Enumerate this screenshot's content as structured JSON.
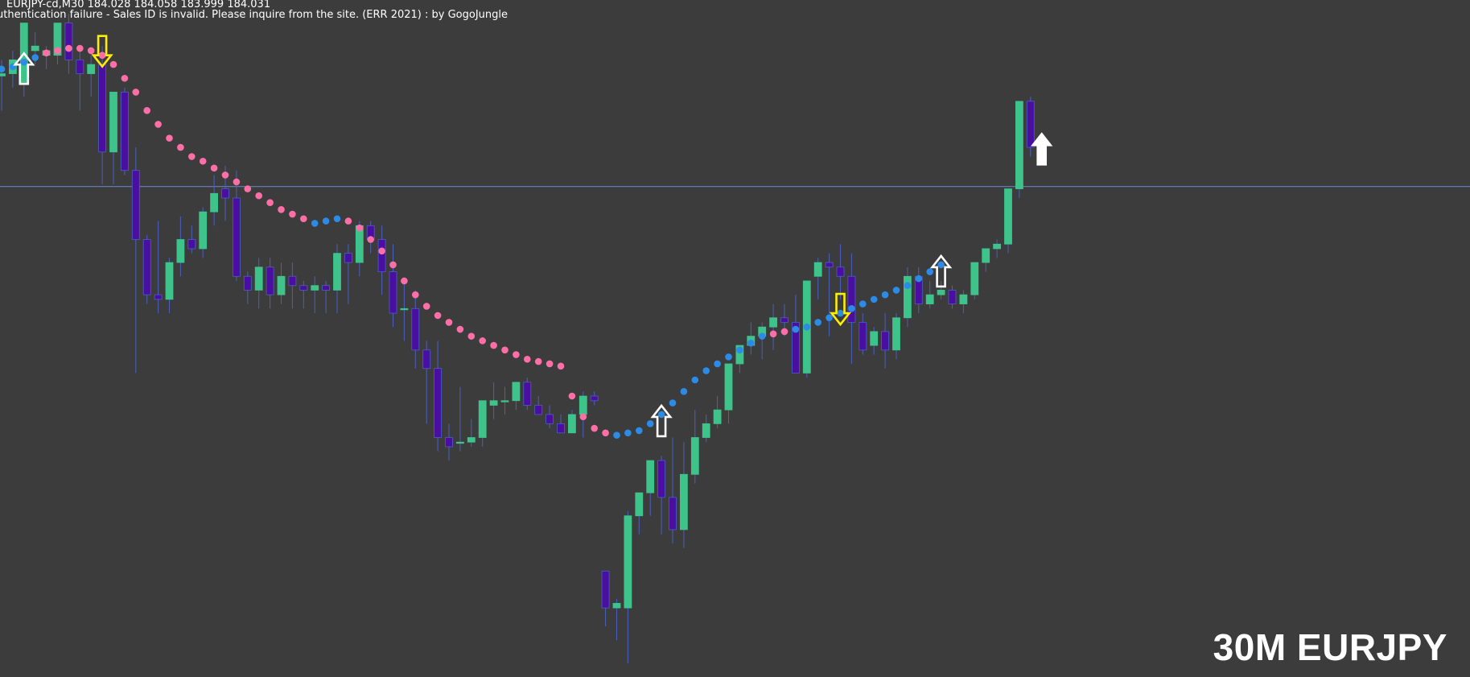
{
  "header": {
    "symbol_line": "EURJPY-cd,M30  184.028 184.058 183.999 184.031",
    "message": "uthentication failure - Sales ID is invalid. Please inquire from the site. (ERR 2021) : by GogoJungle"
  },
  "badge": "30M EURJPY",
  "colors": {
    "background": "#3c3c3c",
    "bull": "#3ec48a",
    "bear": "#4a0fa0",
    "wick": "#4a5fc0",
    "sar_down": "#ff6fa7",
    "sar_up": "#2b8be6",
    "buy_arrow": "#ffffff",
    "sell_arrow": "#ffee00",
    "price_line": "#6c8ccc"
  },
  "chart_data": {
    "type": "candlestick",
    "timeframe": "M30",
    "symbol": "EURJPY",
    "price_line": 183.935,
    "ylim": [
      182.87,
      184.34
    ],
    "candles": [
      [
        184.175,
        184.21,
        184.1,
        184.18
      ],
      [
        184.18,
        184.23,
        184.15,
        184.21
      ],
      [
        184.16,
        184.29,
        184.13,
        184.29
      ],
      [
        184.23,
        184.27,
        184.2,
        184.24
      ],
      [
        184.22,
        184.24,
        184.19,
        184.23
      ],
      [
        184.22,
        184.29,
        184.2,
        184.29
      ],
      [
        184.29,
        184.31,
        184.18,
        184.21
      ],
      [
        184.21,
        184.24,
        184.1,
        184.18
      ],
      [
        184.18,
        184.22,
        184.13,
        184.2
      ],
      [
        184.2,
        184.24,
        183.94,
        184.01
      ],
      [
        184.01,
        184.14,
        183.94,
        184.14
      ],
      [
        184.14,
        184.15,
        183.96,
        183.97
      ],
      [
        183.97,
        184.02,
        183.53,
        183.82
      ],
      [
        183.82,
        183.83,
        183.68,
        183.7
      ],
      [
        183.7,
        183.86,
        183.66,
        183.69
      ],
      [
        183.69,
        183.78,
        183.66,
        183.77
      ],
      [
        183.77,
        183.87,
        183.74,
        183.82
      ],
      [
        183.82,
        183.85,
        183.79,
        183.8
      ],
      [
        183.8,
        183.89,
        183.78,
        183.88
      ],
      [
        183.88,
        183.96,
        183.85,
        183.92
      ],
      [
        183.93,
        183.98,
        183.86,
        183.91
      ],
      [
        183.91,
        183.97,
        183.73,
        183.74
      ],
      [
        183.74,
        183.75,
        183.68,
        183.71
      ],
      [
        183.71,
        183.78,
        183.67,
        183.76
      ],
      [
        183.76,
        183.78,
        183.67,
        183.7
      ],
      [
        183.7,
        183.77,
        183.68,
        183.74
      ],
      [
        183.74,
        183.77,
        183.67,
        183.72
      ],
      [
        183.72,
        183.73,
        183.67,
        183.71
      ],
      [
        183.71,
        183.74,
        183.66,
        183.72
      ],
      [
        183.72,
        183.73,
        183.66,
        183.71
      ],
      [
        183.71,
        183.81,
        183.66,
        183.79
      ],
      [
        183.79,
        183.81,
        183.68,
        183.77
      ],
      [
        183.77,
        183.86,
        183.74,
        183.85
      ],
      [
        183.85,
        183.86,
        183.79,
        183.82
      ],
      [
        183.82,
        183.85,
        183.7,
        183.75
      ],
      [
        183.75,
        183.81,
        183.63,
        183.66
      ],
      [
        183.67,
        183.73,
        183.6,
        183.67
      ],
      [
        183.67,
        183.71,
        183.54,
        183.58
      ],
      [
        183.58,
        183.6,
        183.42,
        183.54
      ],
      [
        183.54,
        183.6,
        183.36,
        183.39
      ],
      [
        183.39,
        183.42,
        183.34,
        183.37
      ],
      [
        183.38,
        183.5,
        183.36,
        183.38
      ],
      [
        183.38,
        183.43,
        183.37,
        183.39
      ],
      [
        183.39,
        183.47,
        183.37,
        183.47
      ],
      [
        183.46,
        183.51,
        183.43,
        183.47
      ],
      [
        183.47,
        183.5,
        183.44,
        183.47
      ],
      [
        183.47,
        183.51,
        183.45,
        183.51
      ],
      [
        183.51,
        183.52,
        183.45,
        183.46
      ],
      [
        183.46,
        183.48,
        183.44,
        183.44
      ],
      [
        183.44,
        183.46,
        183.41,
        183.42
      ],
      [
        183.42,
        183.44,
        183.4,
        183.4
      ],
      [
        183.4,
        183.45,
        183.4,
        183.44
      ],
      [
        183.44,
        183.49,
        183.39,
        183.48
      ],
      [
        183.48,
        183.49,
        183.46,
        183.47
      ],
      [
        183.1,
        183.1,
        182.98,
        183.02
      ],
      [
        183.02,
        183.04,
        182.95,
        183.03
      ],
      [
        183.02,
        183.23,
        182.9,
        183.22
      ],
      [
        183.22,
        183.27,
        183.18,
        183.27
      ],
      [
        183.27,
        183.34,
        183.22,
        183.34
      ],
      [
        183.34,
        183.35,
        183.18,
        183.26
      ],
      [
        183.26,
        183.39,
        183.16,
        183.19
      ],
      [
        183.19,
        183.38,
        183.15,
        183.31
      ],
      [
        183.31,
        183.45,
        183.29,
        183.39
      ],
      [
        183.39,
        183.44,
        183.38,
        183.42
      ],
      [
        183.42,
        183.48,
        183.41,
        183.45
      ],
      [
        183.45,
        183.49,
        183.42,
        183.55
      ],
      [
        183.55,
        183.59,
        183.53,
        183.59
      ],
      [
        183.59,
        183.64,
        183.57,
        183.61
      ],
      [
        183.61,
        183.64,
        183.56,
        183.63
      ],
      [
        183.63,
        183.68,
        183.58,
        183.65
      ],
      [
        183.65,
        183.68,
        183.61,
        183.64
      ],
      [
        183.64,
        183.7,
        183.55,
        183.53
      ],
      [
        183.53,
        183.66,
        183.52,
        183.73
      ],
      [
        183.74,
        183.78,
        183.69,
        183.77
      ],
      [
        183.77,
        183.79,
        183.61,
        183.76
      ],
      [
        183.76,
        183.81,
        183.69,
        183.74
      ],
      [
        183.74,
        183.79,
        183.55,
        183.64
      ],
      [
        183.64,
        183.66,
        183.57,
        183.58
      ],
      [
        183.59,
        183.63,
        183.57,
        183.62
      ],
      [
        183.62,
        183.66,
        183.54,
        183.58
      ],
      [
        183.58,
        183.66,
        183.56,
        183.65
      ],
      [
        183.65,
        183.76,
        183.63,
        183.74
      ],
      [
        183.74,
        183.76,
        183.66,
        183.68
      ],
      [
        183.68,
        183.73,
        183.67,
        183.7
      ],
      [
        183.7,
        183.73,
        183.69,
        183.71
      ],
      [
        183.71,
        183.72,
        183.67,
        183.68
      ],
      [
        183.68,
        183.71,
        183.66,
        183.7
      ],
      [
        183.7,
        183.77,
        183.69,
        183.77
      ],
      [
        183.77,
        183.8,
        183.75,
        183.8
      ],
      [
        183.8,
        183.82,
        183.78,
        183.81
      ],
      [
        183.81,
        183.93,
        183.79,
        183.93
      ],
      [
        183.93,
        184.12,
        183.91,
        184.12
      ],
      [
        184.12,
        184.13,
        184.0,
        184.02
      ],
      [
        184.02,
        184.05,
        184.0,
        184.03
      ]
    ],
    "sar": [
      [
        184.19,
        "up"
      ],
      [
        184.195,
        "up"
      ],
      [
        184.205,
        "up"
      ],
      [
        184.215,
        "up"
      ],
      [
        184.225,
        "down"
      ],
      [
        184.23,
        "down"
      ],
      [
        184.235,
        "down"
      ],
      [
        184.235,
        "down"
      ],
      [
        184.23,
        "down"
      ],
      [
        184.22,
        "down"
      ],
      [
        184.2,
        "down"
      ],
      [
        184.17,
        "down"
      ],
      [
        184.14,
        "down"
      ],
      [
        184.1,
        "down"
      ],
      [
        184.07,
        "down"
      ],
      [
        184.04,
        "down"
      ],
      [
        184.02,
        "down"
      ],
      [
        184.0,
        "down"
      ],
      [
        183.99,
        "down"
      ],
      [
        183.975,
        "down"
      ],
      [
        183.96,
        "down"
      ],
      [
        183.945,
        "down"
      ],
      [
        183.93,
        "down"
      ],
      [
        183.915,
        "down"
      ],
      [
        183.9,
        "down"
      ],
      [
        183.885,
        "down"
      ],
      [
        183.875,
        "down"
      ],
      [
        183.865,
        "down"
      ],
      [
        183.855,
        "up"
      ],
      [
        183.86,
        "up"
      ],
      [
        183.865,
        "up"
      ],
      [
        183.86,
        "down"
      ],
      [
        183.845,
        "down"
      ],
      [
        183.82,
        "down"
      ],
      [
        183.795,
        "down"
      ],
      [
        183.765,
        "down"
      ],
      [
        183.73,
        "down"
      ],
      [
        183.7,
        "down"
      ],
      [
        183.675,
        "down"
      ],
      [
        183.655,
        "down"
      ],
      [
        183.64,
        "down"
      ],
      [
        183.625,
        "down"
      ],
      [
        183.61,
        "down"
      ],
      [
        183.6,
        "down"
      ],
      [
        183.59,
        "down"
      ],
      [
        183.58,
        "down"
      ],
      [
        183.57,
        "down"
      ],
      [
        183.56,
        "down"
      ],
      [
        183.555,
        "down"
      ],
      [
        183.55,
        "down"
      ],
      [
        183.545,
        "down"
      ],
      [
        183.48,
        "down"
      ],
      [
        183.435,
        "down"
      ],
      [
        183.41,
        "down"
      ],
      [
        183.4,
        "down"
      ],
      [
        183.395,
        "up"
      ],
      [
        183.4,
        "up"
      ],
      [
        183.405,
        "up"
      ],
      [
        183.42,
        "up"
      ],
      [
        183.44,
        "up"
      ],
      [
        183.465,
        "up"
      ],
      [
        183.49,
        "up"
      ],
      [
        183.515,
        "up"
      ],
      [
        183.535,
        "up"
      ],
      [
        183.55,
        "up"
      ],
      [
        183.565,
        "up"
      ],
      [
        183.58,
        "up"
      ],
      [
        183.595,
        "up"
      ],
      [
        183.61,
        "up"
      ],
      [
        183.615,
        "down"
      ],
      [
        183.62,
        "down"
      ],
      [
        183.625,
        "up"
      ],
      [
        183.63,
        "up"
      ],
      [
        183.64,
        "up"
      ],
      [
        183.65,
        "up"
      ],
      [
        183.66,
        "up"
      ],
      [
        183.67,
        "up"
      ],
      [
        183.68,
        "up"
      ],
      [
        183.69,
        "up"
      ],
      [
        183.7,
        "up"
      ],
      [
        183.71,
        "up"
      ],
      [
        183.72,
        "up"
      ],
      [
        183.735,
        "up"
      ],
      [
        183.75,
        "up"
      ],
      [
        183.765,
        "up"
      ]
    ],
    "signals": [
      {
        "type": "buy",
        "index": 2
      },
      {
        "type": "sell",
        "index": 9
      },
      {
        "type": "buy",
        "index": 59
      },
      {
        "type": "sell",
        "index": 75
      },
      {
        "type": "buy",
        "index": 84
      },
      {
        "type": "buy",
        "index": 93
      }
    ]
  }
}
